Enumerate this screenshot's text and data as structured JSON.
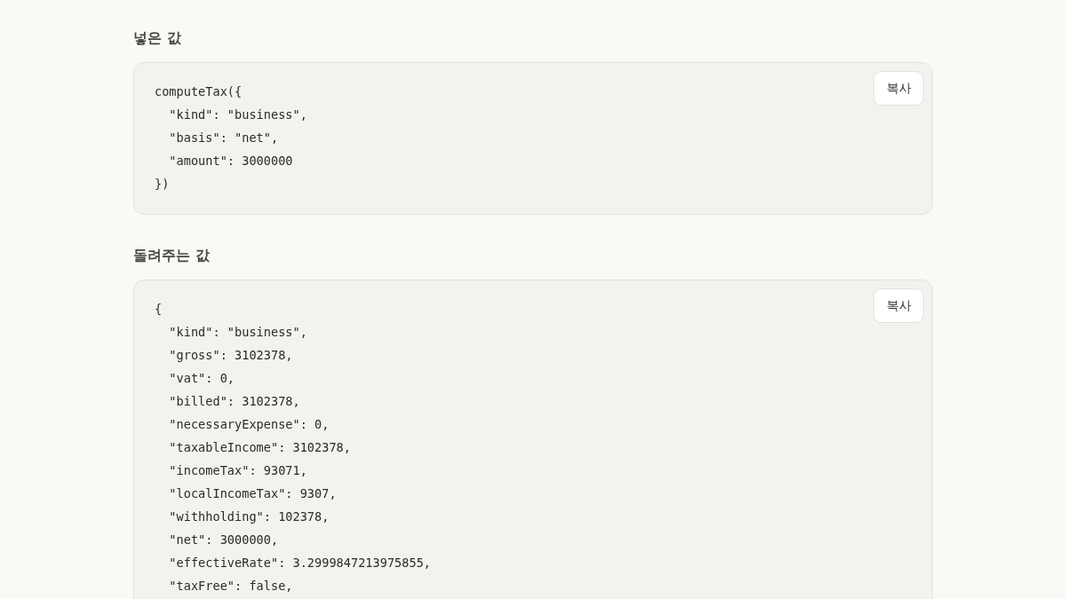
{
  "sections": [
    {
      "heading": "넣은 값",
      "copy_label": "복사",
      "lines": [
        "computeTax({",
        "  \"kind\": \"business\",",
        "  \"basis\": \"net\",",
        "  \"amount\": 3000000",
        "})"
      ]
    },
    {
      "heading": "돌려주는 값",
      "copy_label": "복사",
      "lines": [
        "{",
        "  \"kind\": \"business\",",
        "  \"gross\": 3102378,",
        "  \"vat\": 0,",
        "  \"billed\": 3102378,",
        "  \"necessaryExpense\": 0,",
        "  \"taxableIncome\": 3102378,",
        "  \"incomeTax\": 93071,",
        "  \"localIncomeTax\": 9307,",
        "  \"withholding\": 102378,",
        "  \"net\": 3000000,",
        "  \"effectiveRate\": 3.2999847213975855,",
        "  \"taxFree\": false,"
      ]
    }
  ]
}
